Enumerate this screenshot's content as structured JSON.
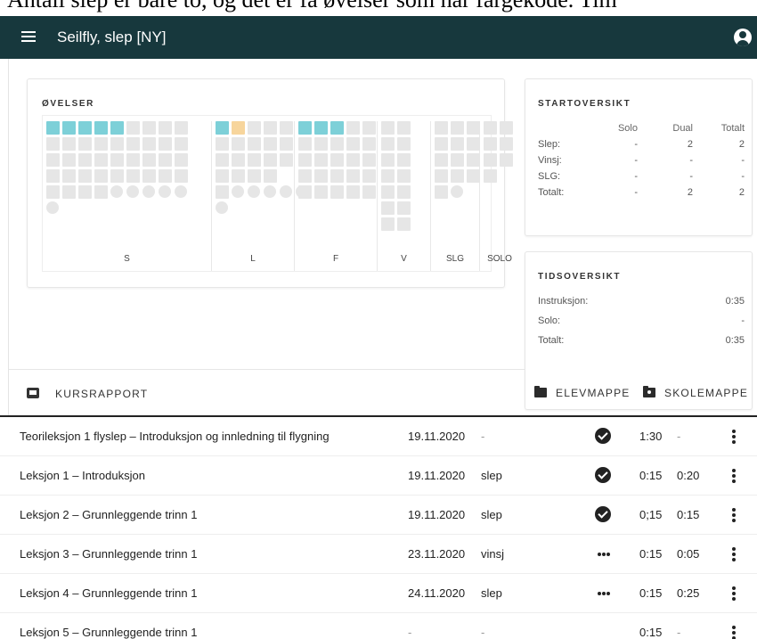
{
  "overlay_text": "Antall slep er bare to, og det er få øvelser som har fargekode. Tim",
  "appbar": {
    "title": "Seilfly, slep [NY]"
  },
  "ovelser": {
    "title": "ØVELSER",
    "groups": [
      {
        "label": "S",
        "cols": 9,
        "done": 5,
        "pending": 0
      },
      {
        "label": "L",
        "cols": 5,
        "done": 1,
        "pending": 1
      },
      {
        "label": "F",
        "cols": 5,
        "done": 3,
        "pending": 0
      },
      {
        "label": "V",
        "cols": 2,
        "done": 0,
        "pending": 0
      },
      {
        "label": "SLG",
        "cols": 3,
        "done": 0,
        "pending": 0
      },
      {
        "label": "SOLO",
        "cols": 2,
        "done": 0,
        "pending": 0
      }
    ]
  },
  "startoversikt": {
    "title": "STARTOVERSIKT",
    "headers": [
      "",
      "Solo",
      "Dual",
      "Totalt"
    ],
    "rows": [
      [
        "Slep:",
        "-",
        "2",
        "2"
      ],
      [
        "Vinsj:",
        "-",
        "-",
        "-"
      ],
      [
        "SLG:",
        "-",
        "-",
        "-"
      ],
      [
        "Totalt:",
        "-",
        "2",
        "2"
      ]
    ]
  },
  "tidsoversikt": {
    "title": "TIDSOVERSIKT",
    "rows": [
      {
        "label": "Instruksjon:",
        "value": "0:35"
      },
      {
        "label": "Solo:",
        "value": "-"
      },
      {
        "label": "Totalt:",
        "value": "0:35"
      }
    ]
  },
  "actions": {
    "kursrapport": "KURSRAPPORT",
    "elevmappe": "ELEVMAPPE",
    "skolemappe": "SKOLEMAPPE"
  },
  "lessons": [
    {
      "name": "Teorileksjon 1 flyslep – Introduksjon og innledning til flygning",
      "date": "19.11.2020",
      "type": "-",
      "status": "check",
      "t1": "1:30",
      "t2": "-"
    },
    {
      "name": "Leksjon 1 – Introduksjon",
      "date": "19.11.2020",
      "type": "slep",
      "status": "check",
      "t1": "0:15",
      "t2": "0:20"
    },
    {
      "name": "Leksjon 2 – Grunnleggende trinn 1",
      "date": "19.11.2020",
      "type": "slep",
      "status": "check",
      "t1": "0;15",
      "t2": "0:15"
    },
    {
      "name": "Leksjon 3 – Grunnleggende trinn 1",
      "date": "23.11.2020",
      "type": "vinsj",
      "status": "more",
      "t1": "0:15",
      "t2": "0:05"
    },
    {
      "name": "Leksjon 4 – Grunnleggende trinn 1",
      "date": "24.11.2020",
      "type": "slep",
      "status": "more",
      "t1": "0:15",
      "t2": "0:25"
    },
    {
      "name": "Leksjon 5 – Grunnleggende trinn 1",
      "date": "-",
      "type": "-",
      "status": "",
      "t1": "0:15",
      "t2": "-"
    }
  ]
}
